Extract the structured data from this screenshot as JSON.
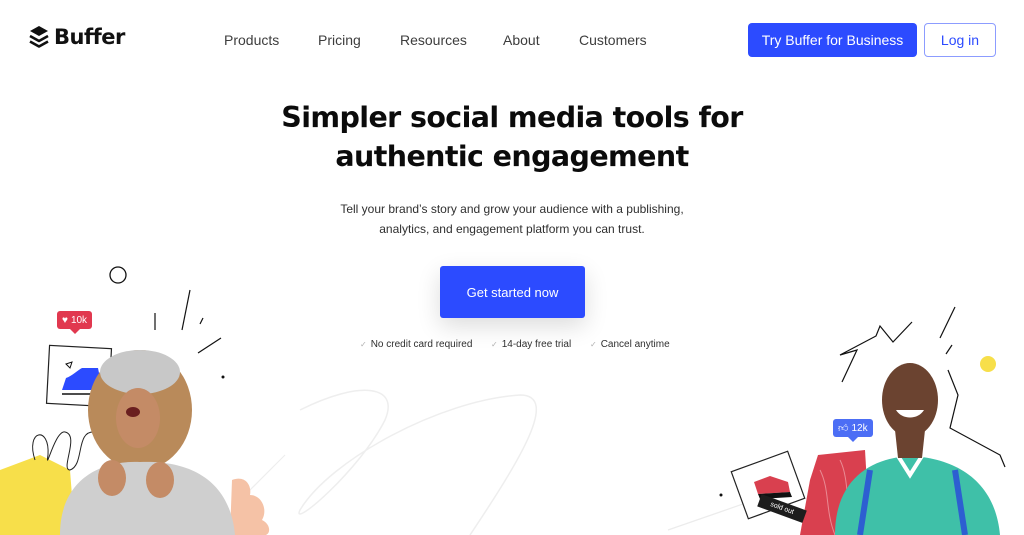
{
  "brand": {
    "name": "Buffer",
    "logo_icon": "stacked-layers-icon",
    "primary_color": "#2c4bff"
  },
  "nav": {
    "items": [
      {
        "label": "Products"
      },
      {
        "label": "Pricing"
      },
      {
        "label": "Resources"
      },
      {
        "label": "About"
      },
      {
        "label": "Customers"
      }
    ],
    "business_button": "Try Buffer for Business",
    "login_button": "Log in"
  },
  "hero": {
    "title_line1": "Simpler social media tools for",
    "title_line2": "authentic engagement",
    "subtitle_line1": "Tell your brand’s story and grow your audience with a publishing,",
    "subtitle_line2": "analytics, and engagement platform you can trust.",
    "cta_label": "Get started now",
    "perks": [
      {
        "icon": "check-icon",
        "label": "No credit card required"
      },
      {
        "icon": "check-icon",
        "label": "14-day free trial"
      },
      {
        "icon": "check-icon",
        "label": "Cancel anytime"
      }
    ]
  },
  "illustration": {
    "left_badge": {
      "icon": "heart-icon",
      "label": "10k",
      "color": "#e1384f"
    },
    "right_badge": {
      "icon": "thumbs-up-icon",
      "label": "12k",
      "color": "#4c6ef5"
    },
    "sold_out_label": "sold out",
    "accent_yellow": "#f7df4a",
    "accent_peach": "#f5c2a6",
    "accent_red": "#d9404f"
  }
}
